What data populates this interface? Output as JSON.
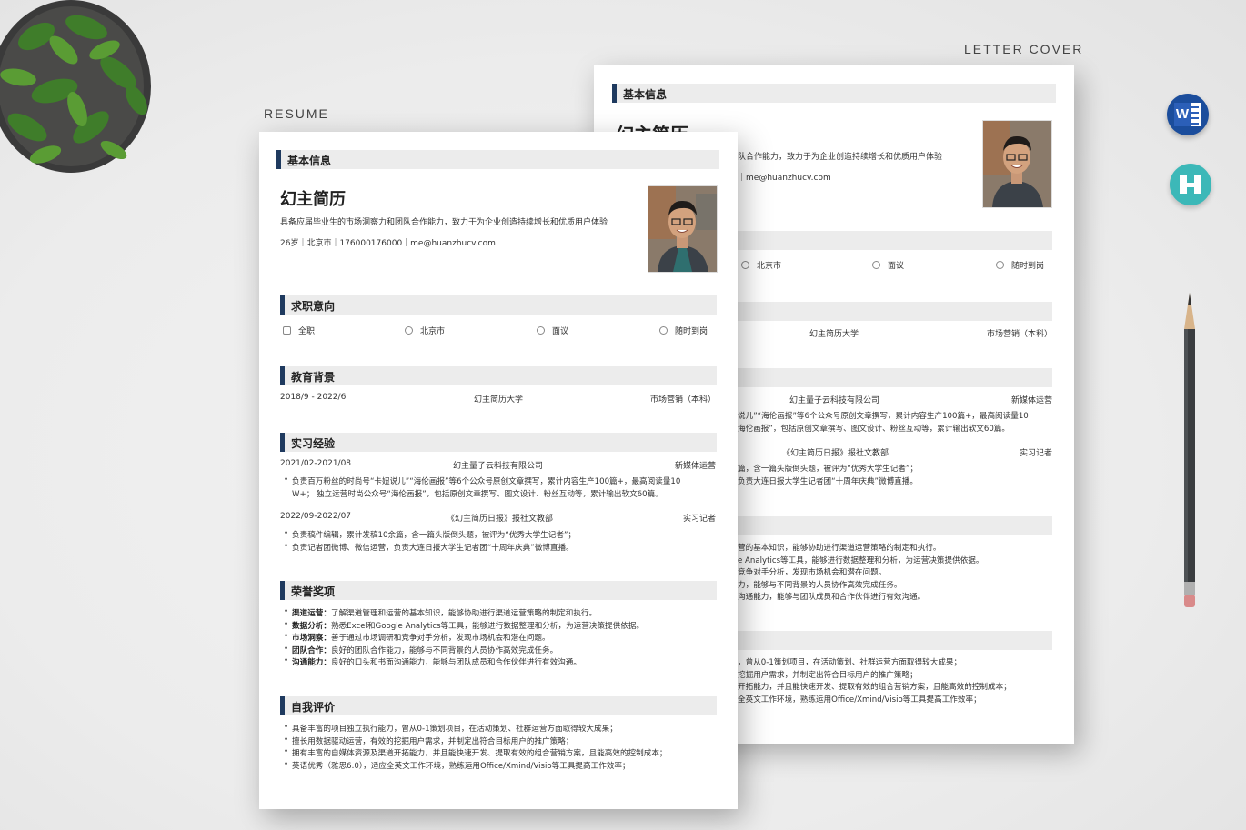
{
  "labels": {
    "resume": "RESUME",
    "letter_cover": "LETTER COVER"
  },
  "resume": {
    "sections": {
      "basic": "基本信息",
      "intent": "求职意向",
      "education": "教育背景",
      "internship": "实习经验",
      "honors": "荣誉奖项",
      "self": "自我评价"
    },
    "name": "幻主简历",
    "summary": "具备应届毕业生的市场洞察力和团队合作能力，致力于为企业创造持续增长和优质用户体验",
    "contact": "26岁｜北京市｜176000176000｜me@huanzhucv.com",
    "intent": [
      {
        "icon": "calendar-icon",
        "label": "全职"
      },
      {
        "icon": "location-icon",
        "label": "北京市"
      },
      {
        "icon": "salary-icon",
        "label": "面议"
      },
      {
        "icon": "clock-icon",
        "label": "随时到岗"
      }
    ],
    "education": {
      "date": "2018/9 - 2022/6",
      "school": "幻主简历大学",
      "major": "市场营销（本科）"
    },
    "internship": [
      {
        "date": "2021/02-2021/08",
        "org": "幻主量子云科技有限公司",
        "role": "新媒体运营",
        "bullets": [
          "负责百万粉丝的时尚号“卡妞说儿”“海伦画报”等6个公众号原创文章撰写，累计内容生产100篇+，最高阅读量10",
          "W+； 独立运营时尚公众号“海伦画报”，包括原创文章撰写、图文设计、粉丝互动等，累计输出软文60篇。"
        ]
      },
      {
        "date": "2022/09-2022/07",
        "org": "《幻主简历日报》报社文教部",
        "role": "实习记者",
        "bullets": [
          "负责稿件编辑，累计发稿10余篇，含一篇头版倒头题，被评为“优秀大学生记者”；",
          "负责记者团微博、微信运营，负责大连日报大学生记者团“十周年庆典”微博直播。"
        ]
      }
    ],
    "honors": [
      {
        "k": "渠道运营：",
        "v": "了解渠道管理和运营的基本知识，能够协助进行渠道运营策略的制定和执行。"
      },
      {
        "k": "数据分析：",
        "v": "熟悉Excel和Google Analytics等工具，能够进行数据整理和分析，为运营决策提供依据。"
      },
      {
        "k": "市场洞察：",
        "v": "善于通过市场调研和竞争对手分析，发现市场机会和潜在问题。"
      },
      {
        "k": "团队合作：",
        "v": "良好的团队合作能力，能够与不同背景的人员协作高效完成任务。"
      },
      {
        "k": "沟通能力：",
        "v": "良好的口头和书面沟通能力，能够与团队成员和合作伙伴进行有效沟通。"
      }
    ],
    "self_eval": [
      "具备丰富的项目独立执行能力，曾从0-1策划项目，在活动策划、社群运营方面取得较大成果；",
      "擅长用数据驱动运营，有效的挖掘用户需求，并制定出符合目标用户的推广策略；",
      "拥有丰富的自媒体资源及渠道开拓能力，并且能快速开发、提取有效的组合营销方案，且能高效的控制成本；",
      "英语优秀（雅思6.0），适应全英文工作环境，熟练运用Office/Xmind/Visio等工具提高工作效率；"
    ]
  },
  "cover": {
    "basic": "基本信息",
    "name_partial": "幻主简历",
    "summary_partial": "队合作能力，致力于为企业创造持续增长和优质用户体验",
    "contact_partial": "me@huanzhucv.com",
    "intent": [
      "北京市",
      "面议",
      "随时到岗"
    ],
    "edu": [
      "幻主简历大学",
      "市场营销（本科）"
    ],
    "exp1": {
      "org": "幻主量子云科技有限公司",
      "role": "新媒体运营",
      "l1": "说儿”“海伦画报”等6个公众号原创文章撰写，累计内容生产100篇+，最高阅读量10",
      "l2": "海伦画报”，包括原创文章撰写、图文设计、粉丝互动等，累计输出软文60篇。"
    },
    "exp2": {
      "org": "《幻主简历日报》报社文教部",
      "role": "实习记者",
      "l1": "篇，含一篇头版倒头题，被评为“优秀大学生记者”；",
      "l2": "负责大连日报大学生记者团“十周年庆典”微博直播。"
    },
    "honors": [
      "营的基本知识，能够协助进行渠道运营策略的制定和执行。",
      "e Analytics等工具，能够进行数据整理和分析，为运营决策提供依据。",
      "竞争对手分析，发现市场机会和潜在问题。",
      "力，能够与不同背景的人员协作高效完成任务。",
      "沟通能力，能够与团队成员和合作伙伴进行有效沟通。"
    ],
    "self": [
      "，曾从0-1策划项目，在活动策划、社群运营方面取得较大成果；",
      "挖掘用户需求，并制定出符合目标用户的推广策略；",
      "开拓能力，并且能快速开发、提取有效的组合营销方案，且能高效的控制成本；",
      "全英文工作环境，熟练运用Office/Xmind/Visio等工具提高工作效率；"
    ]
  },
  "colors": {
    "accent": "#1f3a5f",
    "section_bg": "#ececec",
    "word": "#1b4d9c",
    "teal": "#3cb8b8"
  }
}
